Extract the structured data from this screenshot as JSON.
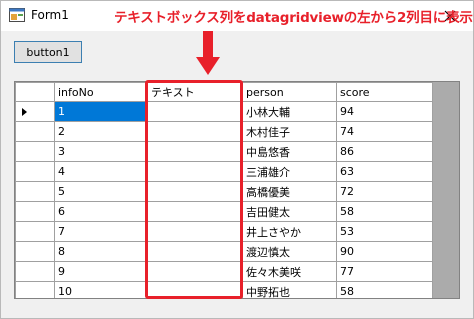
{
  "window": {
    "title": "Form1",
    "icon": "winforms-app-icon",
    "close_icon": "close-icon"
  },
  "annotation": {
    "text": "テキストボックス列をdatagridviewの左から2列目に表示",
    "color": "#e8202a",
    "arrow": "down-arrow-icon"
  },
  "toolbar": {
    "button1_label": "button1"
  },
  "grid": {
    "columns": [
      "infoNo",
      "テキスト",
      "person",
      "score"
    ],
    "current_row_marker": "current-row-arrow-icon",
    "selected_color": "#0078d7",
    "rows": [
      {
        "infoNo": "1",
        "text": "",
        "person": "小林大輔",
        "score": "94"
      },
      {
        "infoNo": "2",
        "text": "",
        "person": "木村佳子",
        "score": "74"
      },
      {
        "infoNo": "3",
        "text": "",
        "person": "中島悠香",
        "score": "86"
      },
      {
        "infoNo": "4",
        "text": "",
        "person": "三浦雄介",
        "score": "63"
      },
      {
        "infoNo": "5",
        "text": "",
        "person": "高橋優美",
        "score": "72"
      },
      {
        "infoNo": "6",
        "text": "",
        "person": "吉田健太",
        "score": "58"
      },
      {
        "infoNo": "7",
        "text": "",
        "person": "井上さやか",
        "score": "53"
      },
      {
        "infoNo": "8",
        "text": "",
        "person": "渡辺慎太",
        "score": "90"
      },
      {
        "infoNo": "9",
        "text": "",
        "person": "佐々木美咲",
        "score": "77"
      },
      {
        "infoNo": "10",
        "text": "",
        "person": "中野拓也",
        "score": "58"
      }
    ]
  }
}
